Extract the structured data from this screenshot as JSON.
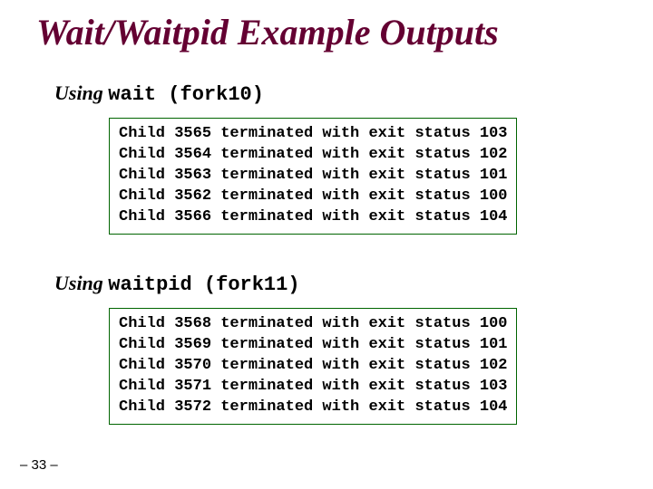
{
  "title": "Wait/Waitpid Example Outputs",
  "section1": {
    "label_prefix": "Using ",
    "label_code": "wait (fork10)",
    "lines": [
      "Child 3565 terminated with exit status 103",
      "Child 3564 terminated with exit status 102",
      "Child 3563 terminated with exit status 101",
      "Child 3562 terminated with exit status 100",
      "Child 3566 terminated with exit status 104"
    ]
  },
  "section2": {
    "label_prefix": "Using ",
    "label_code": "waitpid (fork11)",
    "lines": [
      "Child 3568 terminated with exit status 100",
      "Child 3569 terminated with exit status 101",
      "Child 3570 terminated with exit status 102",
      "Child 3571 terminated with exit status 103",
      "Child 3572 terminated with exit status 104"
    ]
  },
  "footer": "– 33 –"
}
